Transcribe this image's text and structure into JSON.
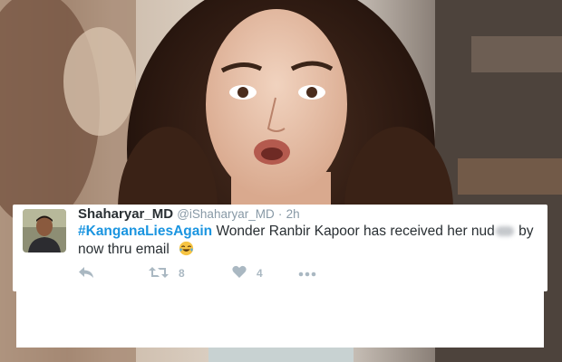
{
  "tweet": {
    "display_name": "Shaharyar_MD",
    "handle": "@iShaharyar_MD",
    "separator": "·",
    "timestamp": "2h",
    "hashtag": "#KanganaLiesAgain",
    "text_before_blur": " Wonder Ranbir Kapoor has received her nud",
    "text_after_blur": " by now thru email",
    "emoji": "tears-of-joy-emoji"
  },
  "actions": {
    "reply_icon": "reply-icon",
    "retweet_icon": "retweet-icon",
    "retweet_count": "8",
    "like_icon": "heart-icon",
    "like_count": "4",
    "more_icon": "more-dots-icon"
  },
  "colors": {
    "hashtag": "#1b95e0",
    "name": "#292f33",
    "muted": "#8899a6",
    "action_icon": "#aab8c2"
  }
}
